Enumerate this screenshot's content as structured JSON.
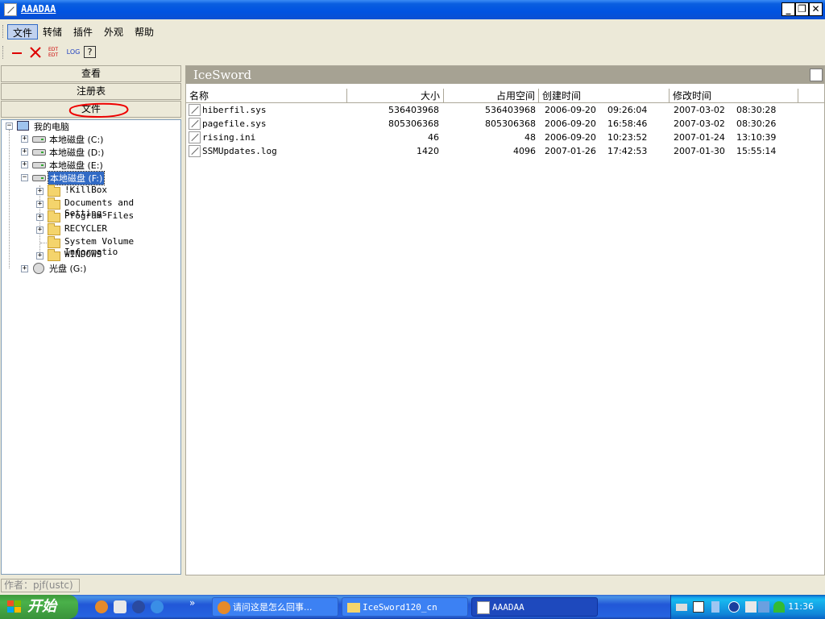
{
  "window": {
    "title": "AAADAA"
  },
  "menu": {
    "items": [
      "文件",
      "转储",
      "插件",
      "外观",
      "帮助"
    ]
  },
  "toolbar": {
    "edt_label": "EDT",
    "log_label": "LOG",
    "help_label": "?"
  },
  "nav": {
    "view": "查看",
    "registry": "注册表",
    "files": "文件"
  },
  "tree": {
    "root": "我的电脑",
    "drives": [
      {
        "label": "本地磁盘 (C:)"
      },
      {
        "label": "本地磁盘 (D:)"
      },
      {
        "label": "本地磁盘 (E:)"
      },
      {
        "label": "本地磁盘 (F:)"
      }
    ],
    "folders": [
      "!KillBox",
      "Documents and Settings",
      "Program Files",
      "RECYCLER",
      "System Volume Informatio",
      "WINDOWS"
    ],
    "cdrom": "光盘 (G:)"
  },
  "panel": {
    "title": "IceSword",
    "columns": {
      "name": "名称",
      "size": "大小",
      "used": "占用空间",
      "created": "创建时间",
      "modified": "修改时间"
    },
    "rows": [
      {
        "name": "hiberfil.sys",
        "size": "536403968",
        "used": "536403968",
        "c_date": "2006-09-20",
        "c_time": "09:26:04",
        "m_date": "2007-03-02",
        "m_time": "08:30:28"
      },
      {
        "name": "pagefile.sys",
        "size": "805306368",
        "used": "805306368",
        "c_date": "2006-09-20",
        "c_time": "16:58:46",
        "m_date": "2007-03-02",
        "m_time": "08:30:26"
      },
      {
        "name": "rising.ini",
        "size": "46",
        "used": "48",
        "c_date": "2006-09-20",
        "c_time": "10:23:52",
        "m_date": "2007-01-24",
        "m_time": "13:10:39"
      },
      {
        "name": "SSMUpdates.log",
        "size": "1420",
        "used": "4096",
        "c_date": "2007-01-26",
        "c_time": "17:42:53",
        "m_date": "2007-01-30",
        "m_time": "15:55:14"
      }
    ]
  },
  "status": {
    "author": "作者：pjf(ustc)"
  },
  "taskbar": {
    "start": "开始",
    "more": "»",
    "tasks": [
      "请问这是怎么回事...",
      "IceSword120_cn",
      "AAADAA"
    ],
    "clock": "11:36"
  }
}
